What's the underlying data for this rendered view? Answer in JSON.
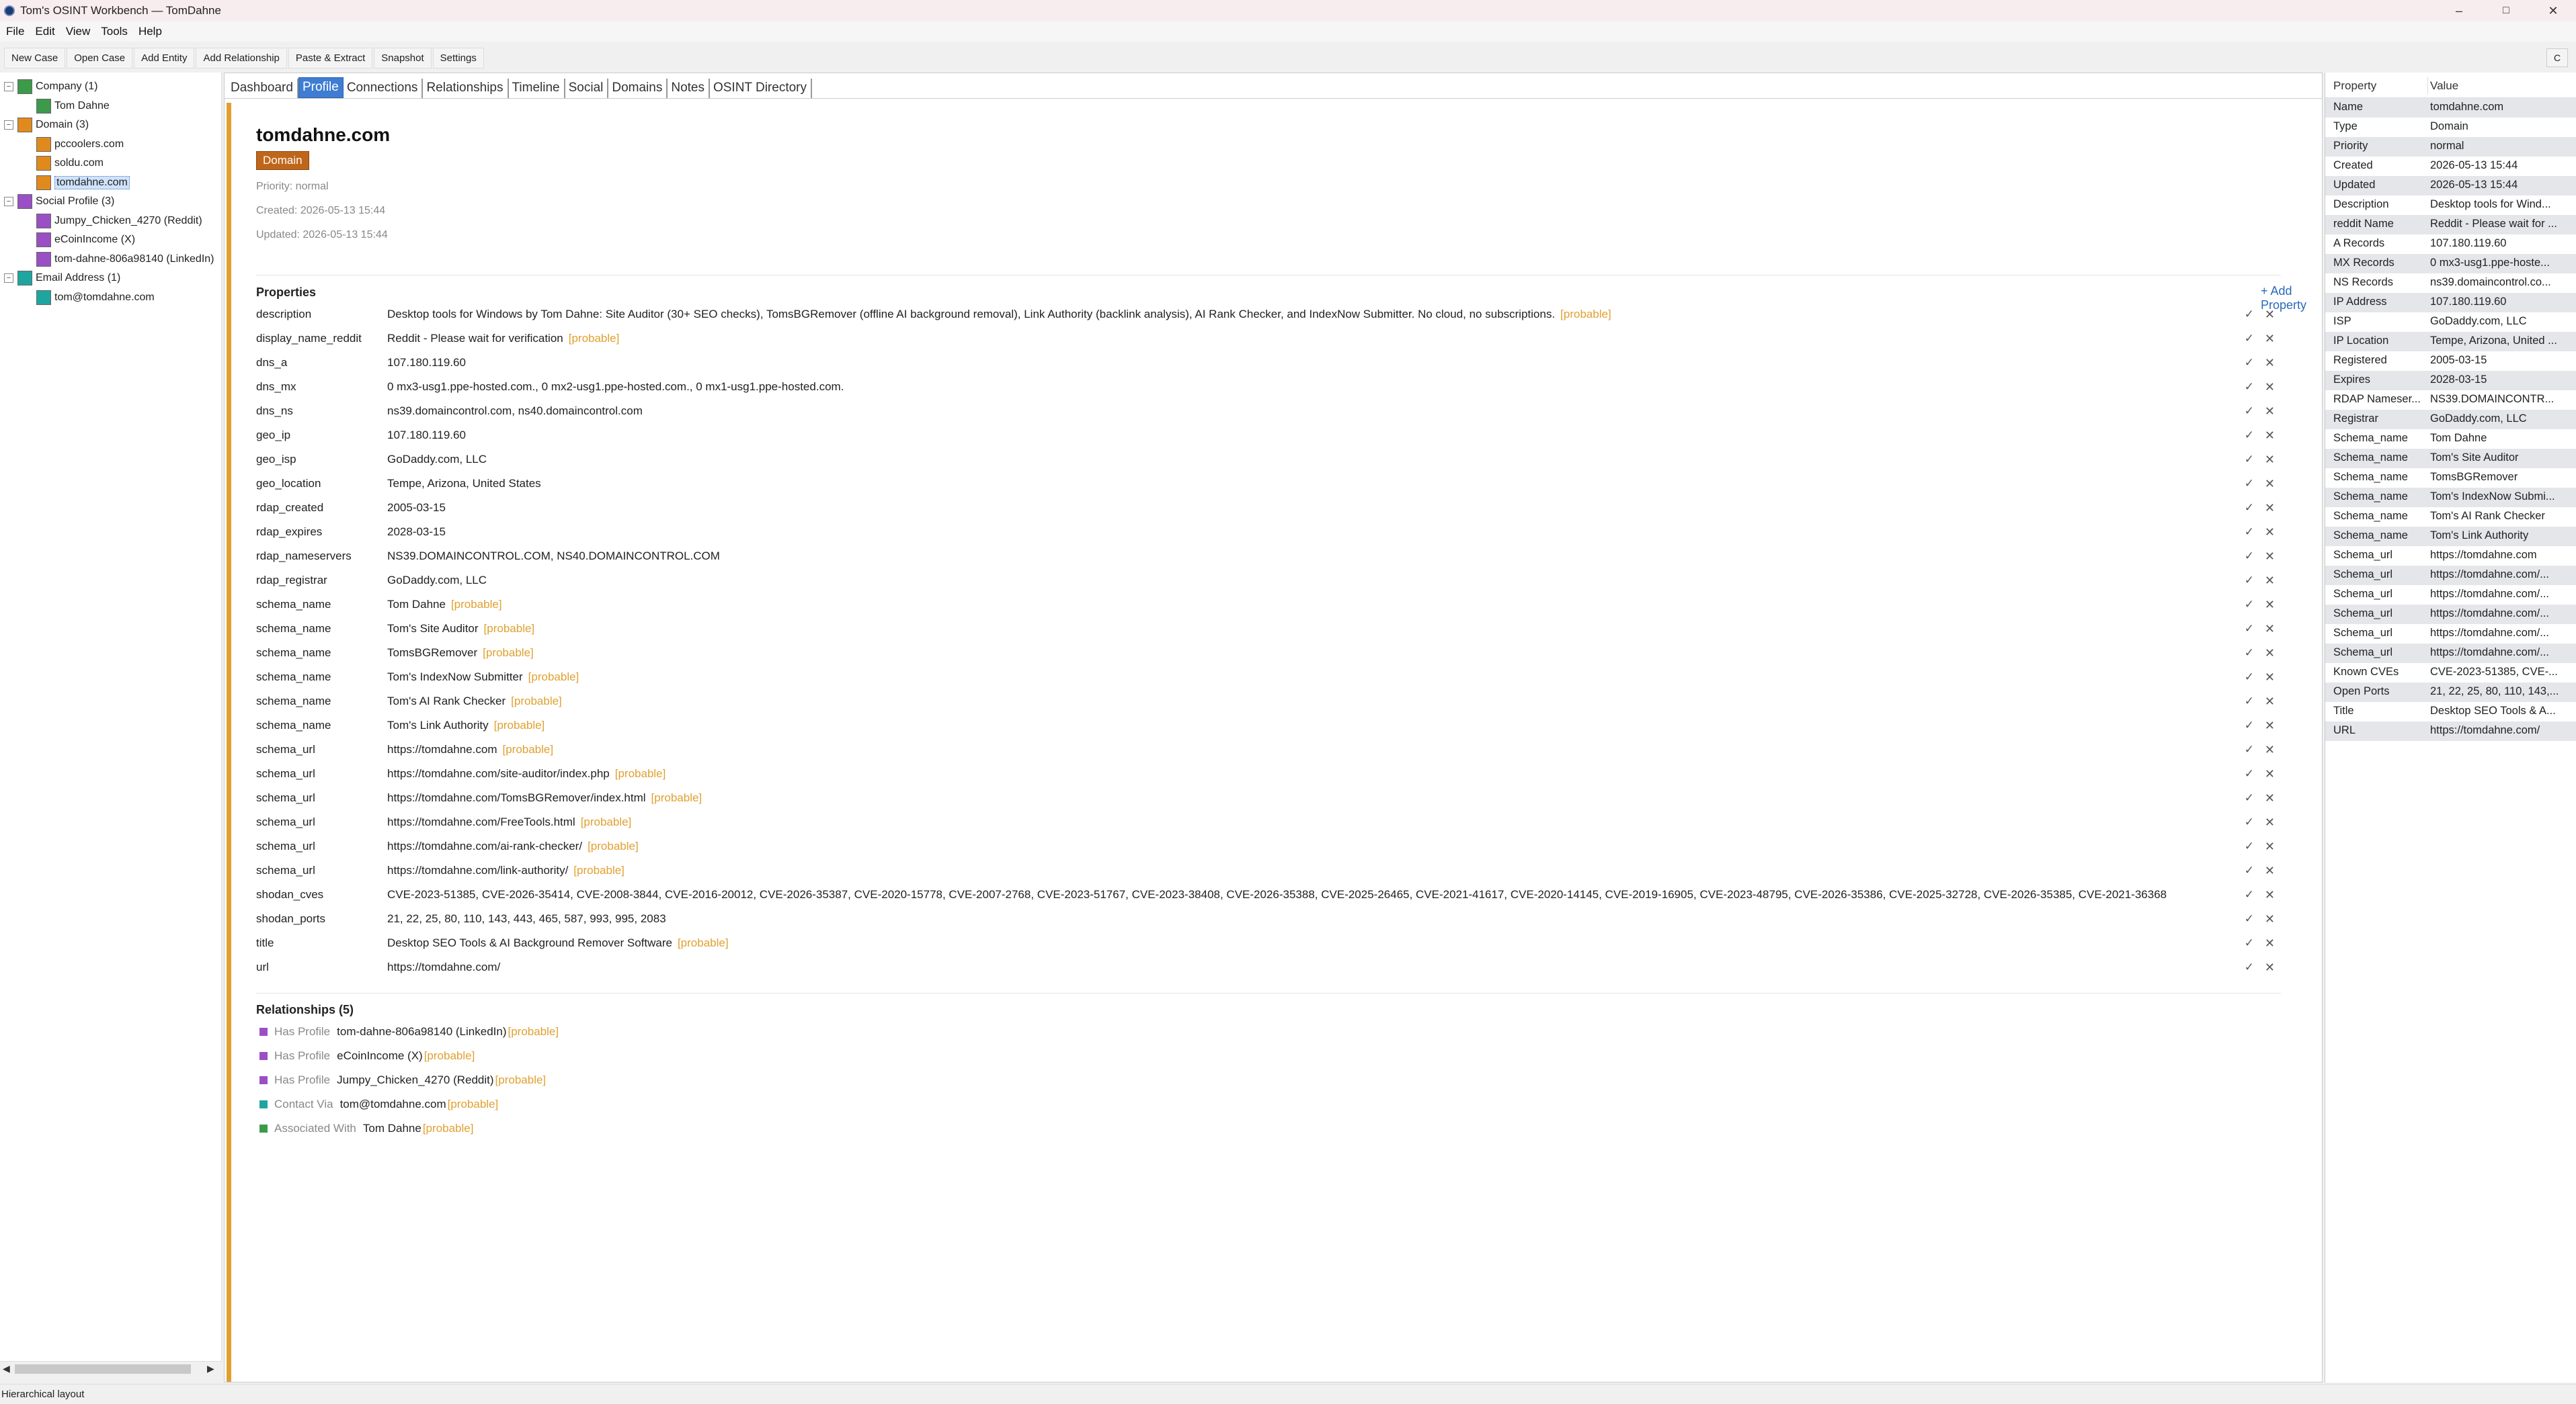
{
  "window": {
    "title": "Tom's OSINT Workbench — TomDahne",
    "minimize": "–",
    "maximize": "□",
    "close": "✕"
  },
  "menu": [
    "File",
    "Edit",
    "View",
    "Tools",
    "Help"
  ],
  "toolbar": {
    "buttons": [
      "New Case",
      "Open Case",
      "Add Entity",
      "Add Relationship",
      "Paste & Extract",
      "Snapshot",
      "Settings"
    ],
    "collapse": "C"
  },
  "tree": [
    {
      "label": "Company (1)",
      "color": "#3c9a4a",
      "group": true
    },
    {
      "label": "Tom Dahne",
      "color": "#3c9a4a"
    },
    {
      "label": "Domain (3)",
      "color": "#e08a1e",
      "group": true
    },
    {
      "label": "pccoolers.com",
      "color": "#e08a1e"
    },
    {
      "label": "soldu.com",
      "color": "#e08a1e"
    },
    {
      "label": "tomdahne.com",
      "color": "#e08a1e",
      "selected": true
    },
    {
      "label": "Social Profile (3)",
      "color": "#9b4fc4",
      "group": true
    },
    {
      "label": "Jumpy_Chicken_4270 (Reddit)",
      "color": "#9b4fc4"
    },
    {
      "label": "eCoinIncome (X)",
      "color": "#9b4fc4"
    },
    {
      "label": "tom-dahne-806a98140 (LinkedIn)",
      "color": "#9b4fc4"
    },
    {
      "label": "Email Address (1)",
      "color": "#1fa5a0",
      "group": true
    },
    {
      "label": "tom@tomdahne.com",
      "color": "#1fa5a0"
    }
  ],
  "tabs": [
    "Dashboard",
    "Profile",
    "Connections",
    "Relationships",
    "Timeline",
    "Social",
    "Domains",
    "Notes",
    "OSINT Directory"
  ],
  "active_tab": "Profile",
  "entity": {
    "name": "tomdahne.com",
    "type": "Domain",
    "priority": "Priority: normal",
    "created": "Created: 2026-05-13 15:44",
    "updated": "Updated: 2026-05-13 15:44"
  },
  "properties_heading": "Properties",
  "add_property": "+ Add Property",
  "probable_label": "[probable]",
  "edit_icon": "✓",
  "delete_icon": "✕",
  "properties": [
    {
      "key": "description",
      "value": "Desktop tools for Windows by Tom Dahne: Site Auditor (30+ SEO checks), TomsBGRemover (offline AI background removal), Link Authority (backlink analysis), AI Rank Checker, and IndexNow Submitter. No cloud, no subscriptions.",
      "probable": true
    },
    {
      "key": "display_name_reddit",
      "value": "Reddit - Please wait for verification",
      "probable": true
    },
    {
      "key": "dns_a",
      "value": "107.180.119.60",
      "probable": false
    },
    {
      "key": "dns_mx",
      "value": "0 mx3-usg1.ppe-hosted.com., 0 mx2-usg1.ppe-hosted.com., 0 mx1-usg1.ppe-hosted.com.",
      "probable": false
    },
    {
      "key": "dns_ns",
      "value": "ns39.domaincontrol.com, ns40.domaincontrol.com",
      "probable": false
    },
    {
      "key": "geo_ip",
      "value": "107.180.119.60",
      "probable": false
    },
    {
      "key": "geo_isp",
      "value": "GoDaddy.com, LLC",
      "probable": false
    },
    {
      "key": "geo_location",
      "value": "Tempe, Arizona, United States",
      "probable": false
    },
    {
      "key": "rdap_created",
      "value": "2005-03-15",
      "probable": false
    },
    {
      "key": "rdap_expires",
      "value": "2028-03-15",
      "probable": false
    },
    {
      "key": "rdap_nameservers",
      "value": "NS39.DOMAINCONTROL.COM, NS40.DOMAINCONTROL.COM",
      "probable": false
    },
    {
      "key": "rdap_registrar",
      "value": "GoDaddy.com, LLC",
      "probable": false
    },
    {
      "key": "schema_name",
      "value": "Tom Dahne",
      "probable": true
    },
    {
      "key": "schema_name",
      "value": "Tom's Site Auditor",
      "probable": true
    },
    {
      "key": "schema_name",
      "value": "TomsBGRemover",
      "probable": true
    },
    {
      "key": "schema_name",
      "value": "Tom's IndexNow Submitter",
      "probable": true
    },
    {
      "key": "schema_name",
      "value": "Tom's AI Rank Checker",
      "probable": true
    },
    {
      "key": "schema_name",
      "value": "Tom's Link Authority",
      "probable": true
    },
    {
      "key": "schema_url",
      "value": "https://tomdahne.com",
      "probable": true
    },
    {
      "key": "schema_url",
      "value": "https://tomdahne.com/site-auditor/index.php",
      "probable": true
    },
    {
      "key": "schema_url",
      "value": "https://tomdahne.com/TomsBGRemover/index.html",
      "probable": true
    },
    {
      "key": "schema_url",
      "value": "https://tomdahne.com/FreeTools.html",
      "probable": true
    },
    {
      "key": "schema_url",
      "value": "https://tomdahne.com/ai-rank-checker/",
      "probable": true
    },
    {
      "key": "schema_url",
      "value": "https://tomdahne.com/link-authority/",
      "probable": true
    },
    {
      "key": "shodan_cves",
      "value": "CVE-2023-51385, CVE-2026-35414, CVE-2008-3844, CVE-2016-20012, CVE-2026-35387, CVE-2020-15778, CVE-2007-2768, CVE-2023-51767, CVE-2023-38408, CVE-2026-35388, CVE-2025-26465, CVE-2021-41617, CVE-2020-14145, CVE-2019-16905, CVE-2023-48795, CVE-2026-35386, CVE-2025-32728, CVE-2026-35385, CVE-2021-36368",
      "probable": false
    },
    {
      "key": "shodan_ports",
      "value": "21, 22, 25, 80, 110, 143, 443, 465, 587, 993, 995, 2083",
      "probable": false
    },
    {
      "key": "title",
      "value": "Desktop SEO Tools & AI Background Remover Software",
      "probable": true
    },
    {
      "key": "url",
      "value": "https://tomdahne.com/",
      "probable": false
    }
  ],
  "relationships_heading": "Relationships (5)",
  "relationships": [
    {
      "type": "Has Profile",
      "target": "tom-dahne-806a98140 (LinkedIn)",
      "color": "#9b4fc4",
      "probable": true
    },
    {
      "type": "Has Profile",
      "target": "eCoinIncome (X)",
      "color": "#9b4fc4",
      "probable": true
    },
    {
      "type": "Has Profile",
      "target": "Jumpy_Chicken_4270 (Reddit)",
      "color": "#9b4fc4",
      "probable": true
    },
    {
      "type": "Contact Via",
      "target": "tom@tomdahne.com",
      "color": "#1fa5a0",
      "probable": true
    },
    {
      "type": "Associated With",
      "target": "Tom Dahne",
      "color": "#3c9a4a",
      "probable": true
    }
  ],
  "right_panel": {
    "col_property": "Property",
    "col_value": "Value",
    "rows": [
      [
        "Name",
        "tomdahne.com"
      ],
      [
        "Type",
        "Domain"
      ],
      [
        "Priority",
        "normal"
      ],
      [
        "Created",
        "2026-05-13 15:44"
      ],
      [
        "Updated",
        "2026-05-13 15:44"
      ],
      [
        "Description",
        "Desktop tools for Wind..."
      ],
      [
        "reddit Name",
        "Reddit - Please wait for ..."
      ],
      [
        "A Records",
        "107.180.119.60"
      ],
      [
        "MX Records",
        "0 mx3-usg1.ppe-hoste..."
      ],
      [
        "NS Records",
        "ns39.domaincontrol.co..."
      ],
      [
        "IP Address",
        "107.180.119.60"
      ],
      [
        "ISP",
        "GoDaddy.com, LLC"
      ],
      [
        "IP Location",
        "Tempe, Arizona, United ..."
      ],
      [
        "Registered",
        "2005-03-15"
      ],
      [
        "Expires",
        "2028-03-15"
      ],
      [
        "RDAP Nameser...",
        "NS39.DOMAINCONTR..."
      ],
      [
        "Registrar",
        "GoDaddy.com, LLC"
      ],
      [
        "Schema_name",
        "Tom Dahne"
      ],
      [
        "Schema_name",
        "Tom's Site Auditor"
      ],
      [
        "Schema_name",
        "TomsBGRemover"
      ],
      [
        "Schema_name",
        "Tom's IndexNow Submi..."
      ],
      [
        "Schema_name",
        "Tom's AI Rank Checker"
      ],
      [
        "Schema_name",
        "Tom's Link Authority"
      ],
      [
        "Schema_url",
        "https://tomdahne.com"
      ],
      [
        "Schema_url",
        "https://tomdahne.com/..."
      ],
      [
        "Schema_url",
        "https://tomdahne.com/..."
      ],
      [
        "Schema_url",
        "https://tomdahne.com/..."
      ],
      [
        "Schema_url",
        "https://tomdahne.com/..."
      ],
      [
        "Schema_url",
        "https://tomdahne.com/..."
      ],
      [
        "Known CVEs",
        "CVE-2023-51385, CVE-..."
      ],
      [
        "Open Ports",
        "21, 22, 25, 80, 110, 143,..."
      ],
      [
        "Title",
        "Desktop SEO Tools & A..."
      ],
      [
        "URL",
        "https://tomdahne.com/"
      ]
    ]
  },
  "status": "Hierarchical layout"
}
